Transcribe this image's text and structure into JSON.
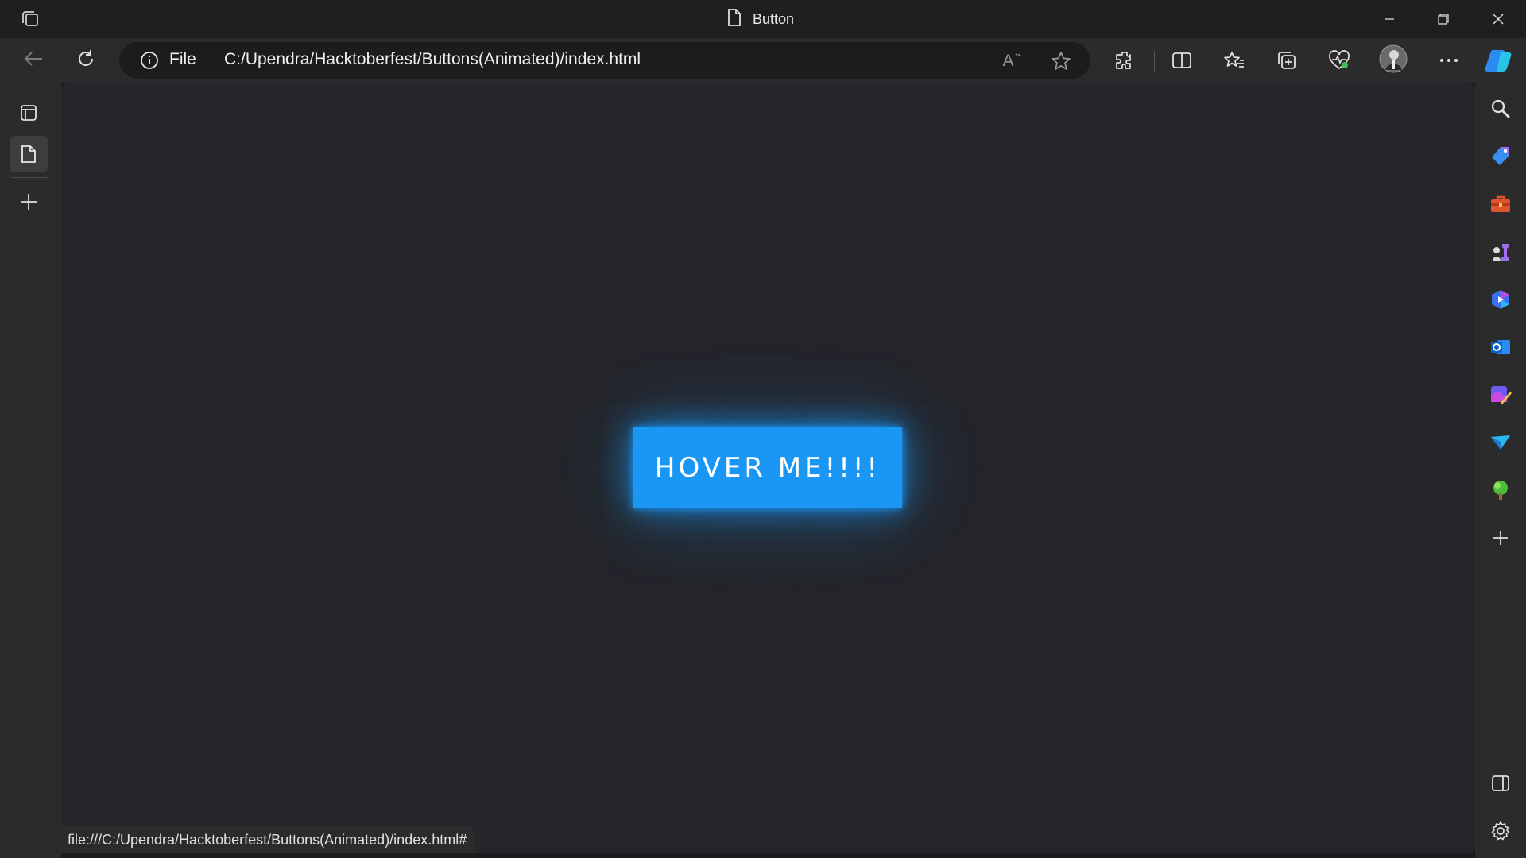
{
  "window": {
    "title": "Button",
    "controls": [
      "minimize",
      "restore",
      "close"
    ]
  },
  "nav": {
    "back_icon": "arrow-left-icon",
    "refresh_icon": "refresh-icon"
  },
  "address": {
    "scheme_label": "File",
    "url": "C:/Upendra/Hacktoberfest/Buttons(Animated)/index.html",
    "read_aloud_label": "A",
    "icons": [
      "info-icon",
      "read-aloud-icon",
      "favorite-star-icon"
    ]
  },
  "toolbar": {
    "icons": [
      "extensions-icon",
      "split-screen-icon",
      "favorites-icon",
      "collections-icon",
      "browser-essentials-icon",
      "profile-avatar",
      "more-menu-icon",
      "copilot-icon"
    ]
  },
  "left_tabs": {
    "icons": [
      "tab-actions-icon",
      "page-tab-icon",
      "new-tab-icon"
    ]
  },
  "right_sidebar": {
    "icons": [
      "search-icon",
      "shopping-icon",
      "tools-icon",
      "games-icon",
      "microsoft365-icon",
      "outlook-icon",
      "designer-icon",
      "send-icon",
      "tree-icon",
      "add-icon",
      "hide-sidebar-icon",
      "settings-icon"
    ]
  },
  "page": {
    "button_label": "HOVER ME!!!!",
    "background": "#25262b",
    "button_color": "#1a96f5"
  },
  "status": {
    "link_url": "file:///C:/Upendra/Hacktoberfest/Buttons(Animated)/index.html#"
  }
}
